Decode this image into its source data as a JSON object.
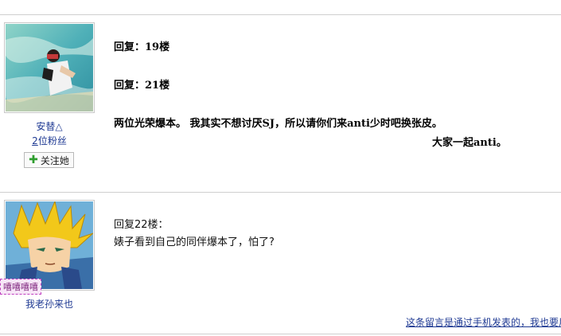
{
  "posts": [
    {
      "username": "安替△",
      "fans": {
        "count": "2",
        "label": "位粉丝"
      },
      "follow_label": "关注她",
      "lines": [
        "回复：19楼",
        "回复：21楼",
        "两位光荣爆本。 我其实不想讨厌SJ，所以请你们来anti少时吧换张皮。",
        "大家一起anti。"
      ],
      "avatar_icon": "photographer-avatar"
    },
    {
      "username": "我老孙来也",
      "badge": "嘻嘻嘻嘻",
      "lines": [
        "回复22楼：",
        "婊子看到自己的同伴爆本了，怕了?"
      ],
      "avatar_icon": "super-saiyan-avatar",
      "footer_link": "这条留言是通过手机发表的，我也要用"
    }
  ],
  "colors": {
    "link": "#1f3a93",
    "rule": "#cfcfcf"
  }
}
